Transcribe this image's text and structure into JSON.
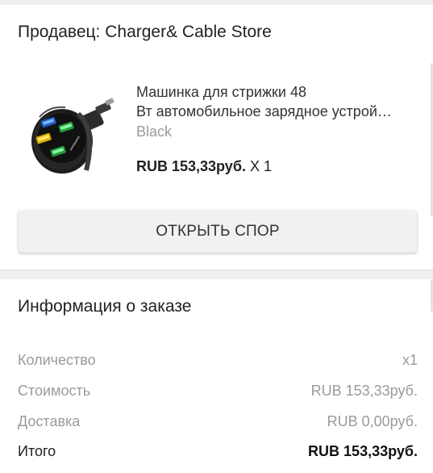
{
  "seller": {
    "title": "Продавец: Charger& Cable Store"
  },
  "product": {
    "title_line1": "Машинка для стрижки 48",
    "title_line2": "Вт автомобильное зарядное устрой…",
    "variant": "Black",
    "price": "RUB 153,33руб.",
    "quantity": "X 1",
    "image_icon": "car-charger-image"
  },
  "actions": {
    "dispute_label": "ОТКРЫТЬ СПОР"
  },
  "order_info": {
    "title": "Информация о заказе",
    "rows": [
      {
        "label": "Количество",
        "value": "x1"
      },
      {
        "label": "Стоимость",
        "value": "RUB 153,33руб."
      },
      {
        "label": "Доставка",
        "value": "RUB 0,00руб."
      }
    ],
    "total": {
      "label": "Итого",
      "value": "RUB 153,33руб."
    }
  },
  "colors": {
    "background": "#efefef",
    "card": "#ffffff",
    "muted_text": "#9a9a9a",
    "button_bg": "#f1f1f1"
  }
}
